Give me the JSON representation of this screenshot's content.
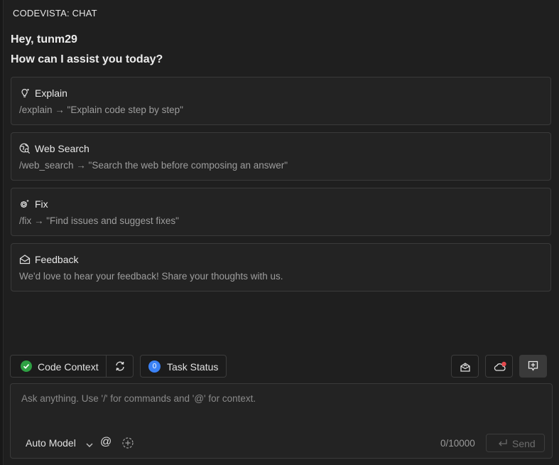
{
  "panel": {
    "title": "CODEVISTA: CHAT"
  },
  "greeting": {
    "hello": "Hey, tunm29",
    "question": "How can I assist you today?"
  },
  "cards": [
    {
      "icon": "lightbulb-icon",
      "title": "Explain",
      "desc": "/explain → \"Explain code step by step\""
    },
    {
      "icon": "globe-search-icon",
      "title": "Web Search",
      "desc": "/web_search → \"Search the web before composing an answer\""
    },
    {
      "icon": "gear-fix-icon",
      "title": "Fix",
      "desc": "/fix → \"Find issues and suggest fixes\""
    },
    {
      "icon": "envelope-icon",
      "title": "Feedback",
      "desc": "We'd love to hear your feedback! Share your thoughts with us."
    }
  ],
  "toolbar": {
    "code_context_label": "Code Context",
    "task_status_badge": "0",
    "task_status_label": "Task Status"
  },
  "input": {
    "placeholder": "Ask anything. Use '/' for commands and '@' for context.",
    "model_label": "Auto Model",
    "at_symbol": "@",
    "counter": "0/10000",
    "send_label": "Send"
  },
  "colors": {
    "check_green": "#2ea043",
    "badge_blue": "#3b82f6",
    "notify_red": "#e5484d"
  }
}
